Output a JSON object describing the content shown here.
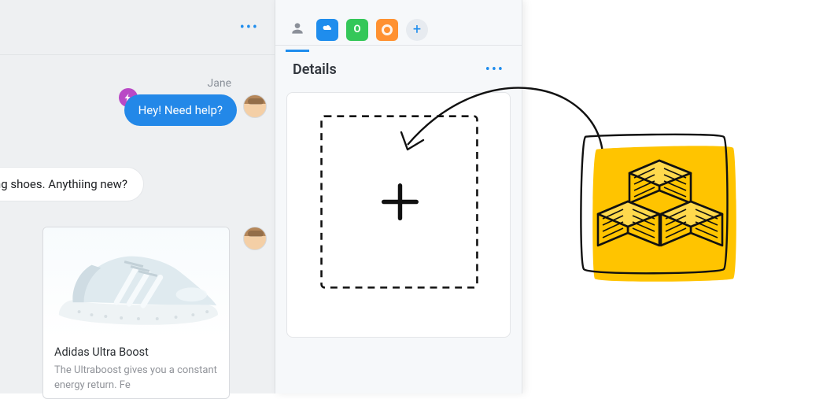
{
  "chat": {
    "sender_name": "Jane",
    "outgoing_message": "Hey! Need help?",
    "incoming_message": "ning shoes. Anythiing new?",
    "product_card": {
      "title": "Adidas Ultra Boost",
      "description": "The Ultraboost gives you a constant energy return. Fe"
    }
  },
  "details_panel": {
    "title": "Details",
    "tabs": {
      "green_letter": "O"
    }
  }
}
